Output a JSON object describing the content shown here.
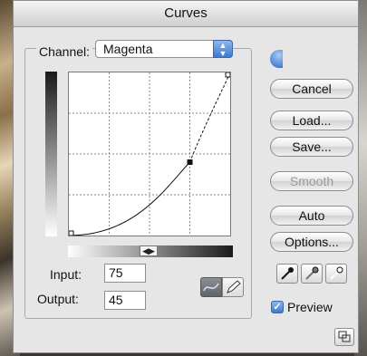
{
  "dialog": {
    "title": "Curves",
    "channel_label": "Channel:",
    "channel_value": "Magenta",
    "input_label": "Input:",
    "input_value": "75",
    "output_label": "Output:",
    "output_value": "45",
    "preview_label": "Preview",
    "preview_checked": true
  },
  "buttons": {
    "cancel": "Cancel",
    "load": "Load...",
    "save": "Save...",
    "smooth": "Smooth",
    "auto": "Auto",
    "options": "Options..."
  },
  "curve": {
    "control_point": {
      "input": 75,
      "output": 45
    },
    "endpoints": [
      {
        "input": 0,
        "output": 0
      },
      {
        "input": 100,
        "output": 100
      }
    ]
  },
  "colors": {
    "accent_blue": "#3f79cf",
    "dialog_bg": "#e6e6e6"
  },
  "icons": {
    "channel_select_arrows": "up-down-arrows-icon",
    "curve_tool": "curve-tool-icon",
    "pencil_tool": "pencil-tool-icon",
    "black_eyedropper": "eyedropper-black-icon",
    "gray_eyedropper": "eyedropper-gray-icon",
    "white_eyedropper": "eyedropper-white-icon",
    "expand": "expand-dialog-icon"
  }
}
